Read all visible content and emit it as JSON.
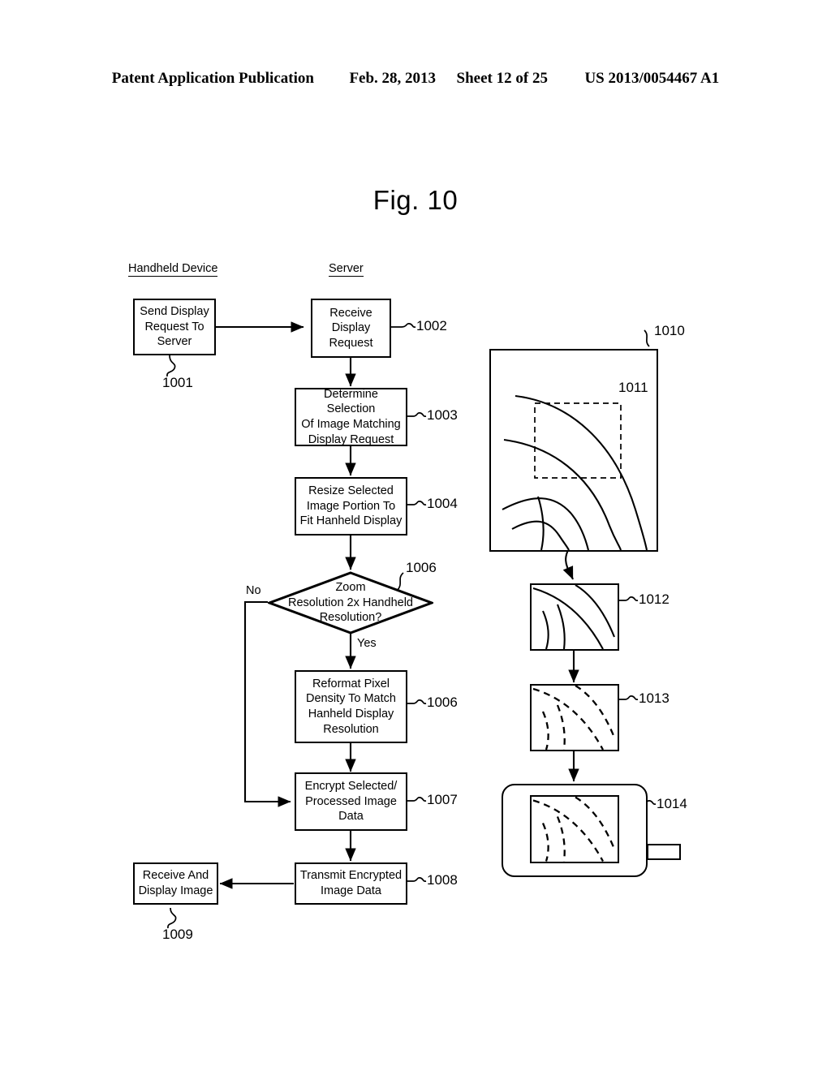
{
  "header": {
    "publication": "Patent Application Publication",
    "date": "Feb. 28, 2013",
    "sheet": "Sheet 12 of 25",
    "docket": "US 2013/0054467 A1"
  },
  "figure": {
    "title": "Fig. 10"
  },
  "columns": {
    "handheld": "Handheld Device",
    "server": "Server"
  },
  "flowchart": {
    "nodes": [
      {
        "id": "1001",
        "ref": "1001",
        "label": "Send Display\nRequest To\nServer",
        "type": "process",
        "lane": "handheld"
      },
      {
        "id": "1002",
        "ref": "1002",
        "label": "Receive\nDisplay\nRequest",
        "type": "process",
        "lane": "server"
      },
      {
        "id": "1003",
        "ref": "1003",
        "label": "Determine Selection\nOf Image Matching\nDisplay Request",
        "type": "process",
        "lane": "server"
      },
      {
        "id": "1004",
        "ref": "1004",
        "label": "Resize Selected\nImage Portion To\nFit Hanheld Display",
        "type": "process",
        "lane": "server"
      },
      {
        "id": "1005",
        "ref": "1006",
        "label": "Zoom\nResolution 2x Handheld\nResolution?",
        "type": "decision",
        "lane": "server"
      },
      {
        "id": "1006",
        "ref": "1006",
        "label": "Reformat Pixel\nDensity To Match\nHanheld Display\nResolution",
        "type": "process",
        "lane": "server"
      },
      {
        "id": "1007",
        "ref": "1007",
        "label": "Encrypt Selected/\nProcessed Image\nData",
        "type": "process",
        "lane": "server"
      },
      {
        "id": "1008",
        "ref": "1008",
        "label": "Transmit Encrypted\nImage Data",
        "type": "process",
        "lane": "server"
      },
      {
        "id": "1009",
        "ref": "1009",
        "label": "Receive And\nDisplay Image",
        "type": "process",
        "lane": "handheld"
      }
    ],
    "branch_labels": {
      "no": "No",
      "yes": "Yes"
    }
  },
  "illustration": {
    "full_image": {
      "ref": "1010",
      "description": "full-resolution-image-panel"
    },
    "selection_region": {
      "ref": "1011",
      "description": "dashed-selection-region"
    },
    "cropped_image": {
      "ref": "1012",
      "description": "resized-image-portion-panel"
    },
    "reformatted_image": {
      "ref": "1013",
      "description": "reformatted-pixel-density-panel"
    },
    "handheld_device": {
      "ref": "1014",
      "description": "handheld-device-with-displayed-image"
    }
  },
  "colors": {
    "ink": "#000000",
    "paper": "#ffffff"
  }
}
